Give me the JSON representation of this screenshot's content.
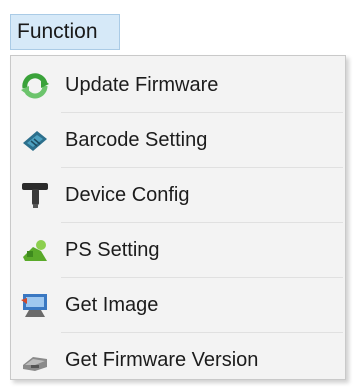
{
  "menubar": {
    "title": "Function"
  },
  "menu": {
    "items": [
      {
        "label": "Update Firmware",
        "icon": "update-firmware-icon"
      },
      {
        "label": "Barcode Setting",
        "icon": "barcode-setting-icon"
      },
      {
        "label": "Device Config",
        "icon": "device-config-icon"
      },
      {
        "label": "PS Setting",
        "icon": "ps-setting-icon"
      },
      {
        "label": "Get Image",
        "icon": "get-image-icon"
      },
      {
        "label": "Get Firmware Version",
        "icon": "get-firmware-version-icon"
      }
    ]
  },
  "colors": {
    "menu_title_bg": "#d6e9f8",
    "dropdown_bg": "#f3f3f3",
    "text": "#1c1c1c"
  }
}
